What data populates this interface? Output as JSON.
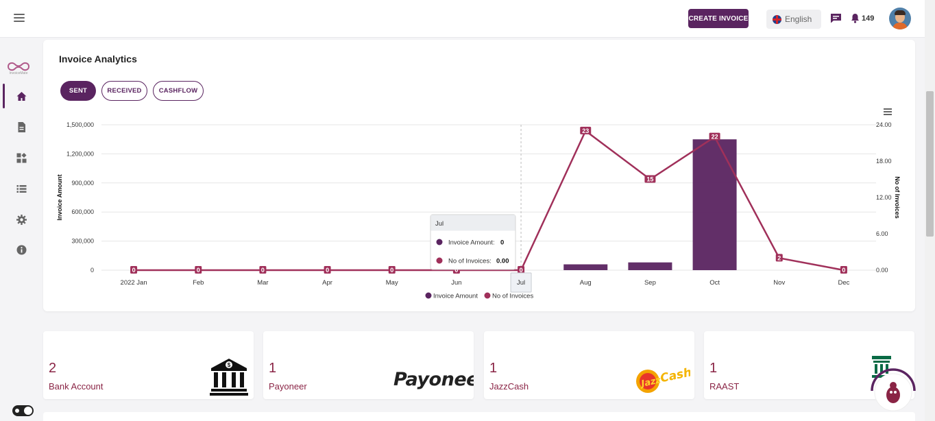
{
  "header": {
    "create_invoice_label": "CREATE INVOICE",
    "language": "English",
    "notification_count": "149"
  },
  "sidebar": {
    "logo_text": "InvoiceMate",
    "items": [
      {
        "icon": "home-icon",
        "active": true
      },
      {
        "icon": "document-icon",
        "active": false
      },
      {
        "icon": "dashboard-widgets-icon",
        "active": false
      },
      {
        "icon": "list-icon",
        "active": false
      },
      {
        "icon": "gear-icon",
        "active": false
      },
      {
        "icon": "info-icon",
        "active": false
      }
    ]
  },
  "analytics": {
    "title": "Invoice Analytics",
    "tabs": [
      {
        "label": "SENT",
        "active": true
      },
      {
        "label": "RECEIVED",
        "active": false
      },
      {
        "label": "CASHFLOW",
        "active": false
      }
    ],
    "tooltip": {
      "title": "Jul",
      "rows": [
        {
          "label": "Invoice Amount:",
          "value": "0",
          "color": "#5a2460"
        },
        {
          "label": "No of Invoices:",
          "value": "0.00",
          "color": "#a0305a"
        }
      ]
    }
  },
  "chart_data": {
    "type": "bar",
    "categories": [
      "2022 Jan",
      "Feb",
      "Mar",
      "Apr",
      "May",
      "Jun",
      "Jul",
      "Aug",
      "Sep",
      "Oct",
      "Nov",
      "Dec"
    ],
    "series": [
      {
        "name": "Invoice Amount",
        "type": "bar",
        "axis": "left",
        "color": "#5a2460",
        "values": [
          0,
          0,
          0,
          0,
          0,
          0,
          0,
          60000,
          80000,
          1350000,
          0,
          0
        ]
      },
      {
        "name": "No of Invoices",
        "type": "line",
        "axis": "right",
        "color": "#a0305a",
        "values": [
          0,
          0,
          0,
          0,
          0,
          0,
          0,
          23,
          15,
          22,
          2,
          0
        ]
      }
    ],
    "ylabel": "Invoice Amount",
    "ylabel_right": "No of Invoices",
    "ylim": [
      0,
      1500000
    ],
    "ylim_right": [
      0,
      24
    ],
    "y_ticks": [
      "1,500,000",
      "1,200,000",
      "900,000",
      "600,000",
      "300,000",
      "0"
    ],
    "y_ticks_right": [
      "24.00",
      "18.00",
      "12.00",
      "6.00",
      "0.00"
    ],
    "grid": true,
    "legend": "bottom-center",
    "highlighted_category": "Jul"
  },
  "accounts": [
    {
      "count": "2",
      "label": "Bank Account",
      "logo": "bank-icon"
    },
    {
      "count": "1",
      "label": "Payoneer",
      "logo": "Payoneer"
    },
    {
      "count": "1",
      "label": "JazzCash",
      "logo": "JazzCash"
    },
    {
      "count": "1",
      "label": "RAAST",
      "logo": "raast-logo"
    }
  ]
}
